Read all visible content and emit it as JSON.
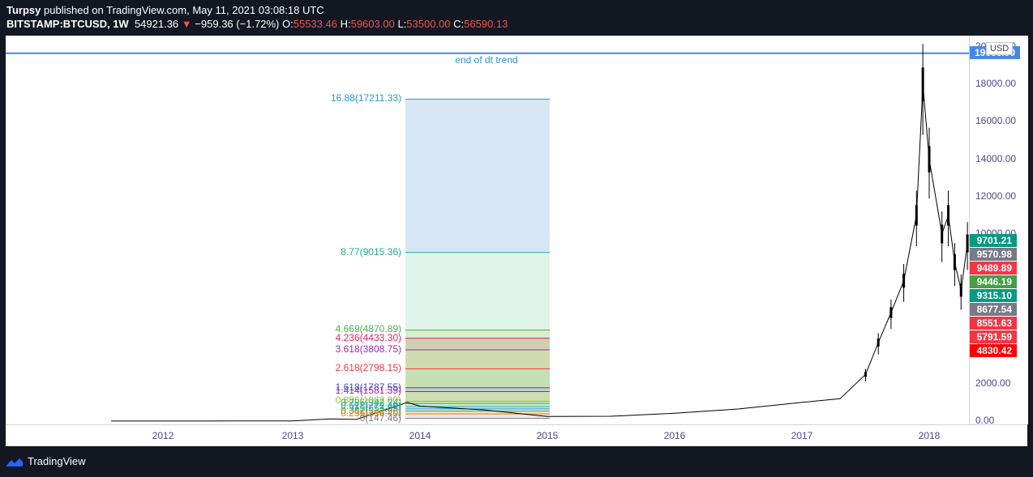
{
  "header": {
    "author": "Turpsy",
    "published_text": "published on TradingView.com, May 11, 2021 03:08:18 UTC",
    "symbol": "BITSTAMP:BTCUSD, 1W",
    "last": "54921.36",
    "arrow": "▼",
    "change": "−959.36 (−1.72%)",
    "o_label": "O:",
    "o_value": "55533.46",
    "h_label": "H:",
    "h_value": "59603.00",
    "l_label": "L:",
    "l_value": "53500.00",
    "c_label": "C:",
    "c_value": "56590.13"
  },
  "annotation": "end of dt trend",
  "currency": "USD",
  "top_price_tag": "19666.00",
  "price_tags": [
    {
      "text": "9701.21",
      "color": "#089981"
    },
    {
      "text": "9570.98",
      "color": "#787b86"
    },
    {
      "text": "9489.89",
      "color": "#f23645"
    },
    {
      "text": "9446.19",
      "color": "#43a047"
    },
    {
      "text": "9315.10",
      "color": "#089981"
    },
    {
      "text": "8677.54",
      "color": "#787b86"
    },
    {
      "text": "8551.63",
      "color": "#f23645"
    },
    {
      "text": "5791.59",
      "color": "#f23645"
    },
    {
      "text": "4830.42",
      "color": "#ff0000"
    }
  ],
  "fib_levels": [
    {
      "label": "16.88(17211.33)",
      "price": 17211.33,
      "color": "#2a94d6"
    },
    {
      "label": "8.77(9015.36)",
      "price": 9015.36,
      "color": "#22ab94"
    },
    {
      "label": "4.669(4870.89)",
      "price": 4870.89,
      "color": "#4caf50"
    },
    {
      "label": "4.236(4433.30)",
      "price": 4433.3,
      "color": "#e91e63"
    },
    {
      "label": "3.618(3808.75)",
      "price": 3808.75,
      "color": "#9c27b0"
    },
    {
      "label": "2.618(2798.15)",
      "price": 2798.15,
      "color": "#f23645"
    },
    {
      "label": "1.618(1787.55)",
      "price": 1787.55,
      "color": "#3f51b5"
    },
    {
      "label": "1.414(1581.39)",
      "price": 1581.39,
      "color": "#9c27b0"
    },
    {
      "label": "0.886(1062.00)",
      "price": 1062.0,
      "color": "#8bc34a"
    },
    {
      "label": "0.786(942.24)",
      "price": 942.24,
      "color": "#4caf50"
    },
    {
      "label": "0.618(772.49)",
      "price": 772.49,
      "color": "#22ab94"
    },
    {
      "label": "0.5(653.23)",
      "price": 653.23,
      "color": "#2196f3"
    },
    {
      "label": "0.382(533.96)",
      "price": 533.96,
      "color": "#4caf50"
    },
    {
      "label": "0.236(386.40)",
      "price": 386.4,
      "color": "#f57c00"
    },
    {
      "label": "0(147.46)",
      "price": 147.46,
      "color": "#787b86"
    }
  ],
  "chart_data": {
    "type": "candlestick",
    "x_tick_labels": [
      "2012",
      "2013",
      "2014",
      "2015",
      "2016",
      "2017",
      "2018"
    ],
    "y_tick_labels": [
      "0.00",
      "2000.00",
      "4000.00",
      "6000.00",
      "8000.00",
      "10000.00",
      "12000.00",
      "14000.00",
      "16000.00",
      "18000.00",
      "20000.00"
    ],
    "ylim": [
      0,
      20000
    ],
    "horizontal_line": 19666.0,
    "x": [
      "2011.6",
      "2012.0",
      "2012.5",
      "2013.0",
      "2013.3",
      "2013.5",
      "2013.9",
      "2014.0",
      "2014.5",
      "2015.0",
      "2015.5",
      "2016.0",
      "2016.5",
      "2017.0",
      "2017.3",
      "2017.5",
      "2017.6",
      "2017.7",
      "2017.8",
      "2017.9",
      "2017.95",
      "2018.0",
      "2018.1",
      "2018.15",
      "2018.2",
      "2018.25",
      "2018.3"
    ],
    "close": [
      5,
      6,
      8,
      15,
      120,
      90,
      1000,
      800,
      600,
      250,
      260,
      420,
      650,
      1000,
      1200,
      2500,
      4200,
      5800,
      7500,
      11000,
      18000,
      14000,
      10000,
      11000,
      8500,
      7000,
      9500
    ]
  },
  "footer": {
    "brand": "TradingView"
  }
}
